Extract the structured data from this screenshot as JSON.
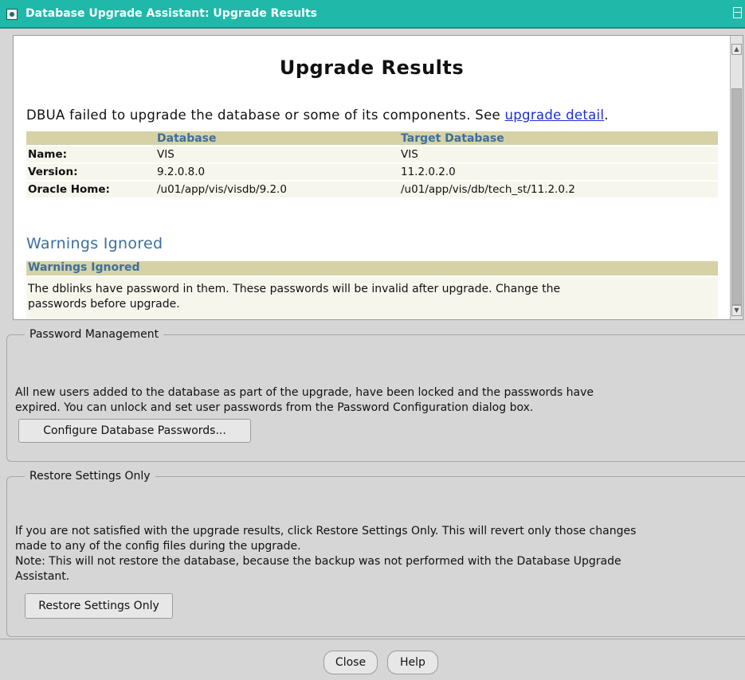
{
  "window": {
    "title": "Database Upgrade Assistant: Upgrade Results"
  },
  "results": {
    "heading": "Upgrade Results",
    "summary_text": "DBUA failed to upgrade the database or some of its components. See ",
    "summary_link": "upgrade detail",
    "summary_end": ".",
    "table": {
      "headers": [
        "",
        "Database",
        "Target Database"
      ],
      "rows": [
        {
          "label": "Name:",
          "database": "VIS",
          "target": "VIS"
        },
        {
          "label": "Version:",
          "database": "9.2.0.8.0",
          "target": "11.2.0.2.0"
        },
        {
          "label": "Oracle Home:",
          "database": "/u01/app/vis/visdb/9.2.0",
          "target": "/u01/app/vis/db/tech_st/11.2.0.2"
        }
      ]
    },
    "warnings_title": "Warnings Ignored",
    "warnings_header": "Warnings Ignored",
    "warnings_line1": "The dblinks have password in them. These passwords will be invalid after upgrade. Change the",
    "warnings_line2": "passwords before upgrade."
  },
  "password_management": {
    "legend": "Password Management",
    "line1": "All new users added to the database as part of the upgrade, have been locked and the passwords have",
    "line2": "expired. You can unlock and set user passwords from the Password Configuration dialog box.",
    "button": "Configure Database Passwords..."
  },
  "restore_settings": {
    "legend": "Restore Settings Only",
    "line1": "If you are not satisfied with the upgrade results, click Restore Settings Only. This will revert only those changes",
    "line2": "made to any of the config files during the upgrade.",
    "line3": "Note: This will not restore the database, because the backup was not performed with the Database Upgrade",
    "line4": "Assistant.",
    "button": "Restore Settings Only"
  },
  "footer": {
    "close": "Close",
    "help": "Help"
  }
}
